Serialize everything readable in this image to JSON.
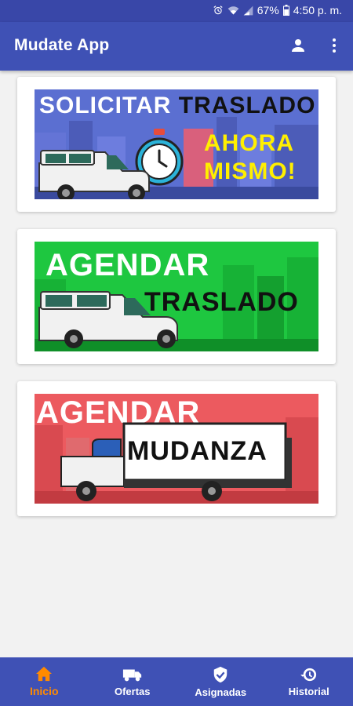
{
  "status_bar": {
    "battery": "67%",
    "time": "4:50 p. m.",
    "icons": [
      "alarm-icon",
      "wifi-icon",
      "signal-icon",
      "battery-icon"
    ]
  },
  "app_bar": {
    "title": "Mudate App",
    "icons": [
      "account-icon",
      "more-vert-icon"
    ]
  },
  "cards": [
    {
      "line1_part1": "SOLICITAR",
      "line1_part2": "TRASLADO",
      "line2": "AHORA",
      "line3": "MISMO!",
      "bg_color": "#4a5cc0",
      "vehicle": "pickup-truck",
      "icon": "stopwatch-icon"
    },
    {
      "line1": "AGENDAR",
      "line2": "TRASLADO",
      "bg_color": "#19c13a",
      "vehicle": "pickup-truck"
    },
    {
      "line1": "AGENDAR",
      "line2": "MUDANZA",
      "bg_color": "#e85156",
      "vehicle": "box-truck"
    }
  ],
  "bottom_nav": {
    "items": [
      {
        "label": "Inicio",
        "icon": "home-icon",
        "active": true
      },
      {
        "label": "Ofertas",
        "icon": "truck-icon",
        "active": false
      },
      {
        "label": "Asignadas",
        "icon": "shield-check-icon",
        "active": false
      },
      {
        "label": "Historial",
        "icon": "history-icon",
        "active": false
      }
    ]
  },
  "colors": {
    "primary": "#3f51b5",
    "status_bar": "#3947a8",
    "accent": "#ff8a00",
    "yellow_text": "#ffef00"
  }
}
